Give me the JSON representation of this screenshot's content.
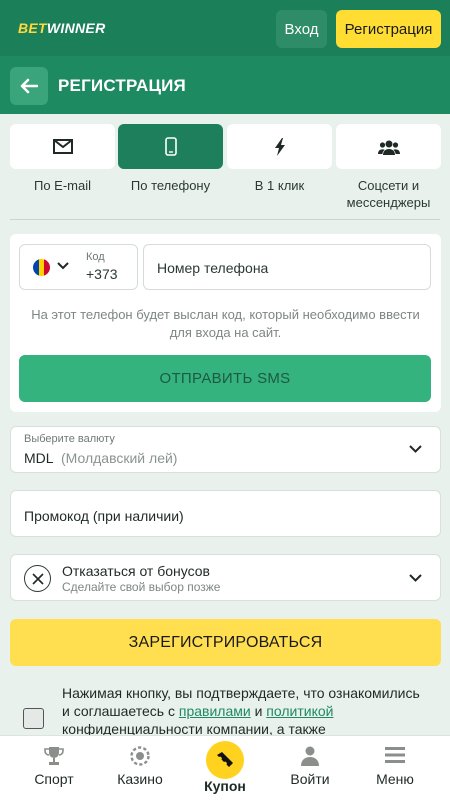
{
  "header": {
    "logo_bet": "BET",
    "logo_winner": "WINNER",
    "login_label": "Вход",
    "register_label": "Регистрация"
  },
  "subheader": {
    "title": "РЕГИСТРАЦИЯ",
    "back_icon": "arrow-left-icon"
  },
  "tabs": [
    {
      "label": "По E-mail",
      "icon": "envelope-icon",
      "active": false
    },
    {
      "label": "По телефону",
      "icon": "phone-icon",
      "active": true
    },
    {
      "label": "В 1 клик",
      "icon": "lightning-icon",
      "active": false
    },
    {
      "label": "Соцсети и мессенджеры",
      "icon": "users-icon",
      "active": false
    }
  ],
  "phone_form": {
    "code_label": "Код",
    "code_value": "+373",
    "country_flag": "moldova-flag",
    "phone_placeholder": "Номер телефона",
    "hint": "На этот телефон будет выслан код, который необходимо ввести для входа на сайт.",
    "send_sms_label": "ОТПРАВИТЬ SMS"
  },
  "currency": {
    "label": "Выберите валюту",
    "code": "MDL",
    "name": "(Молдавский лей)"
  },
  "promo": {
    "placeholder": "Промокод (при наличии)"
  },
  "bonus": {
    "title": "Отказаться от бонусов",
    "subtitle": "Сделайте свой выбор позже"
  },
  "register_button": "ЗАРЕГИСТРИРОВАТЬСЯ",
  "terms": {
    "part1": "Нажимая кнопку, вы подтверждаете, что ознакомились и соглашаетесь с ",
    "rules_link": "правилами",
    "part2": " и ",
    "policy_link": "политикой",
    "part3": " конфиденциальности компании, а также"
  },
  "bottom_nav": [
    {
      "label": "Спорт",
      "icon": "trophy-icon"
    },
    {
      "label": "Казино",
      "icon": "casino-chip-icon"
    },
    {
      "label": "Купон",
      "icon": "coupon-icon"
    },
    {
      "label": "Войти",
      "icon": "user-icon"
    },
    {
      "label": "Меню",
      "icon": "menu-icon"
    }
  ],
  "colors": {
    "brand_green": "#1b7f5a",
    "accent_yellow": "#ffdd33",
    "sms_button": "#34b37f"
  }
}
